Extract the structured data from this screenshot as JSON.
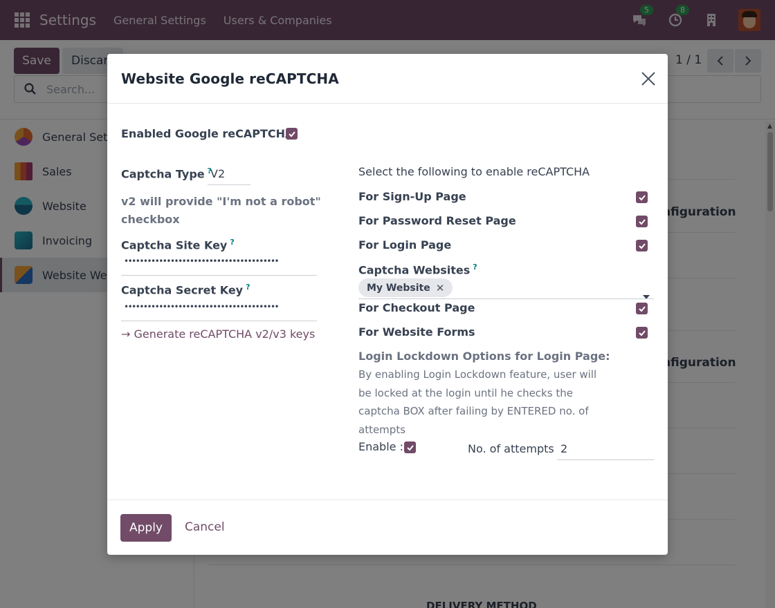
{
  "navbar": {
    "app_name": "Settings",
    "menus": [
      "General Settings",
      "Users & Companies"
    ],
    "chat_count": "5",
    "activity_count": "8",
    "color": "#714b67"
  },
  "control_panel": {
    "save_label": "Save",
    "discard_label": "Discard",
    "search_placeholder": "Search...",
    "pager": "1 / 1"
  },
  "sidebar": {
    "items": [
      {
        "label": "General Settings",
        "icon": "general-settings-icon"
      },
      {
        "label": "Sales",
        "icon": "sales-icon"
      },
      {
        "label": "Website",
        "icon": "website-icon"
      },
      {
        "label": "Invoicing",
        "icon": "invoicing-icon"
      },
      {
        "label": "Website Web",
        "icon": "website-web-icon"
      }
    ]
  },
  "background": {
    "configuration_1": "nfiguration",
    "configuration_2": "nfiguration",
    "delivery": "DELIVERY METHOD"
  },
  "modal": {
    "title": "Website Google reCAPTCHA",
    "enabled_label": "Enabled Google reCAPTCHA:",
    "enabled": true,
    "captcha_type_label": "Captcha Type",
    "captcha_type_value": "V2",
    "help_mark": "?",
    "captcha_type_hint": "v2 will provide \"I'm not a robot\" checkbox",
    "site_key_label": "Captcha Site Key",
    "site_key_value": "••••••••••••••••••••••••••••••••••••••••",
    "secret_key_label": "Captcha Secret Key",
    "secret_key_value": "••••••••••••••••••••••••••••••••••••••••",
    "generate_link": "→ Generate reCAPTCHA v2/v3 keys",
    "right_intro": "Select the following to enable reCAPTCHA",
    "signup_label": "For Sign-Up Page",
    "password_reset_label": "For Password Reset Page",
    "login_label": "For Login Page",
    "websites_label": "Captcha Websites",
    "website_tag": "My Website",
    "checkout_label": "For Checkout Page",
    "forms_label": "For Website Forms",
    "lockdown_title": "Login Lockdown Options for Login Page:",
    "lockdown_desc": "By enabling Login Lockdown feature, user will be locked at the login until he checks the captcha BOX after failing by ENTERED no. of attempts",
    "enable_label": "Enable :",
    "attempts_label": "No. of attempts",
    "attempts_value": "2",
    "apply_label": "Apply",
    "cancel_label": "Cancel"
  }
}
